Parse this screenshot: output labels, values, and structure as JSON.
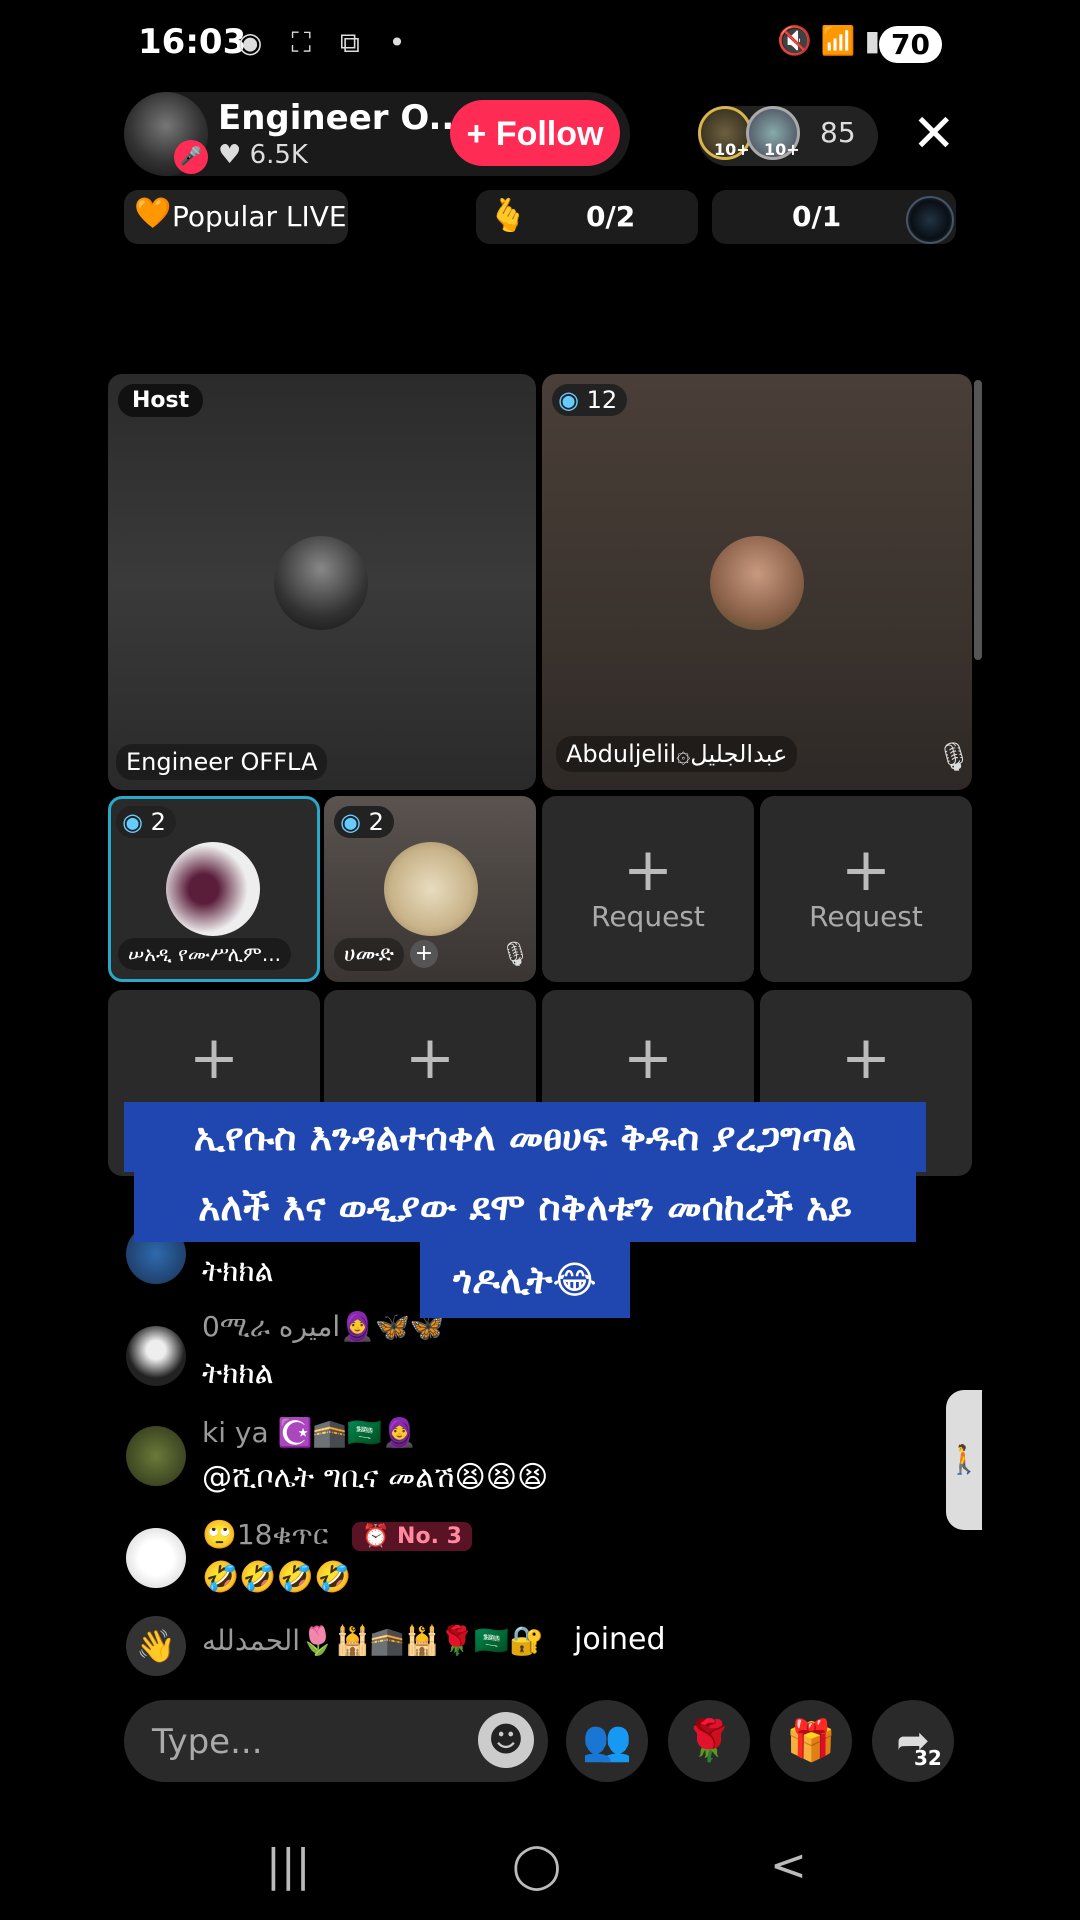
{
  "status": {
    "time": "16:03",
    "left_icons": "◉ ⛶ ⧉ •",
    "right_icons": "🔇 📶 ▮",
    "battery": "70"
  },
  "host": {
    "name": "Engineer O...",
    "likes": "♥ 6.5K",
    "follow_label": "+ Follow"
  },
  "viewers": {
    "count": "85",
    "badge": "10+"
  },
  "popular": {
    "icon": "🧡",
    "label": "Popular LIVE"
  },
  "goals": [
    {
      "icon": "🫰",
      "text": "0/2"
    },
    {
      "text": "0/1"
    }
  ],
  "grid": {
    "host_tag": "Host",
    "host_name": "Engineer OFFLA",
    "guest1": {
      "badge": "12",
      "name": "Abduljelil۞عبدالجليل"
    },
    "guest2": {
      "badge": "2",
      "name": "ሠአዲ የሙሥሊም..."
    },
    "guest3": {
      "badge": "2",
      "name": "ሀሙድ"
    },
    "request_label": "Request",
    "plus": "+"
  },
  "caption": {
    "line1": "ኢየሱስ እንዳልተሰቀለ መፀሀፍ ቅዱስ ያረጋግጣል",
    "line2": "አለች እና ወዲያው ደሞ ስቅለቱን መሰከረች አይ",
    "line3": "ጎዶሊት😂"
  },
  "chat": [
    {
      "name": "",
      "msg": "ትክክል"
    },
    {
      "name": "0ሚራ اميره🧕🦋🦋",
      "msg": "ትክክል"
    },
    {
      "name": "ki ya ☪️🕋🇸🇦🧕",
      "msg": "@ሺቦሌት ግቢና መልሽ😫😫😫"
    },
    {
      "name": "🙄18ቁጥር",
      "rank": "⏰ No. 3",
      "msg": "🤣🤣🤣🤣"
    },
    {
      "name": "الحمدلله🌷🕌🕋🕌🌹🇸🇦🔐",
      "msg": "joined"
    }
  ],
  "input": {
    "placeholder": "Type..."
  },
  "share_count": "32",
  "nav": {
    "recents": "|||",
    "home": "◯",
    "back": "<"
  }
}
